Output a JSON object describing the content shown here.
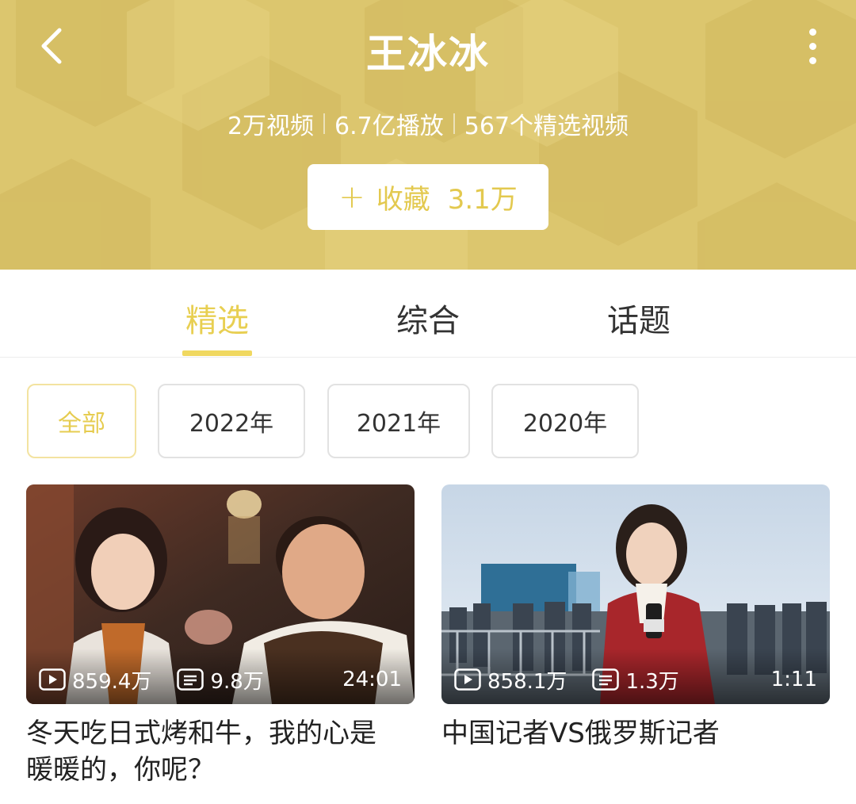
{
  "header": {
    "title": "王冰冰",
    "stats": [
      "2万视频",
      "6.7亿播放",
      "567个精选视频"
    ],
    "favorite_label": "收藏",
    "favorite_count": "3.1万",
    "accent_color": "#dcc66e"
  },
  "tabs": [
    {
      "label": "精选",
      "active": true
    },
    {
      "label": "综合",
      "active": false
    },
    {
      "label": "话题",
      "active": false
    }
  ],
  "filters": [
    {
      "label": "全部",
      "active": true
    },
    {
      "label": "2022年",
      "active": false
    },
    {
      "label": "2021年",
      "active": false
    },
    {
      "label": "2020年",
      "active": false
    }
  ],
  "videos": [
    {
      "plays": "859.4万",
      "comments": "9.8万",
      "duration": "24:01",
      "title_line1": "冬天吃日式烤和牛，我的心是",
      "title_line2": "暖暖的，你呢？"
    },
    {
      "plays": "858.1万",
      "comments": "1.3万",
      "duration": "1:11",
      "title_line1": "中国记者VS俄罗斯记者",
      "title_line2": ""
    }
  ],
  "icons": {
    "back": "back-arrow-icon",
    "more": "more-vertical-icon",
    "play": "play-icon",
    "comment": "danmaku-icon"
  }
}
